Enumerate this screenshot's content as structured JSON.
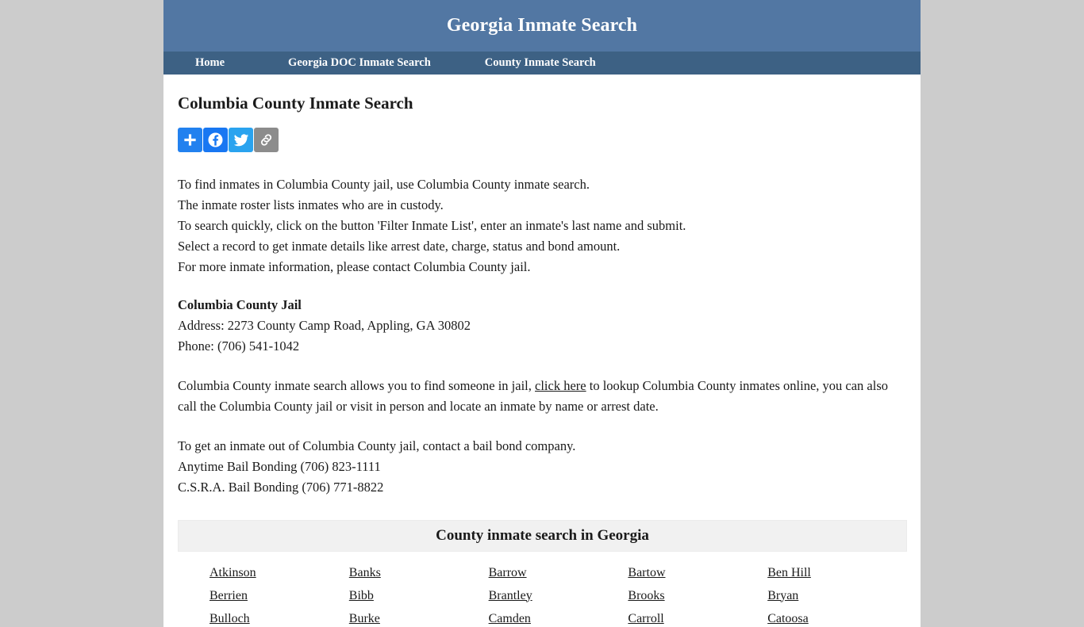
{
  "header": {
    "site_title": "Georgia Inmate Search",
    "background_color": "#5277a3"
  },
  "nav": {
    "background_color": "#3d6184",
    "items": [
      {
        "label": "Home",
        "name": "nav-home"
      },
      {
        "label": "Georgia DOC Inmate Search",
        "name": "nav-georgia-doc-inmate-search"
      },
      {
        "label": "County Inmate Search",
        "name": "nav-county-inmate-search"
      }
    ]
  },
  "main": {
    "page_title": "Columbia County Inmate Search",
    "share": [
      {
        "icon": "addthis-plus-icon",
        "label": "Share",
        "color": "#2281ef"
      },
      {
        "icon": "facebook-icon",
        "label": "Facebook",
        "color": "#1877f2"
      },
      {
        "icon": "twitter-icon",
        "label": "Twitter",
        "color": "#2aa3ef"
      },
      {
        "icon": "copy-link-icon",
        "label": "Copy Link",
        "color": "#8c8c8c"
      }
    ],
    "intro_lines": [
      "To find inmates in Columbia County jail, use Columbia County inmate search.",
      "The inmate roster lists inmates who are in custody.",
      "To search quickly, click on the button 'Filter Inmate List', enter an inmate's last name and submit.",
      "Select a record to get inmate details like arrest date, charge, status and bond amount.",
      "For more inmate information, please contact Columbia County jail."
    ],
    "jail": {
      "name": "Columbia County Jail",
      "address": "Address: 2273 County Camp Road, Appling, GA 30802",
      "phone": "Phone: (706) 541-1042"
    },
    "search_paragraph": {
      "before_link": "Columbia County inmate search allows you to find someone in jail, ",
      "link_text": "click here",
      "after_link": " to lookup Columbia County inmates online, you can also call the Columbia County jail or visit in person and locate an inmate by name or arrest date."
    },
    "bail_lines": [
      "To get an inmate out of Columbia County jail, contact a bail bond company.",
      "Anytime Bail Bonding (706) 823-1111",
      "C.S.R.A. Bail Bonding (706) 771-8822"
    ]
  },
  "county_table": {
    "title": "County inmate search in Georgia",
    "header_background": "#f1f1f1",
    "counties": [
      "Atkinson",
      "Banks",
      "Barrow",
      "Bartow",
      "Ben Hill",
      "Berrien",
      "Bibb",
      "Brantley",
      "Brooks",
      "Bryan",
      "Bulloch",
      "Burke",
      "Camden",
      "Carroll",
      "Catoosa"
    ]
  }
}
